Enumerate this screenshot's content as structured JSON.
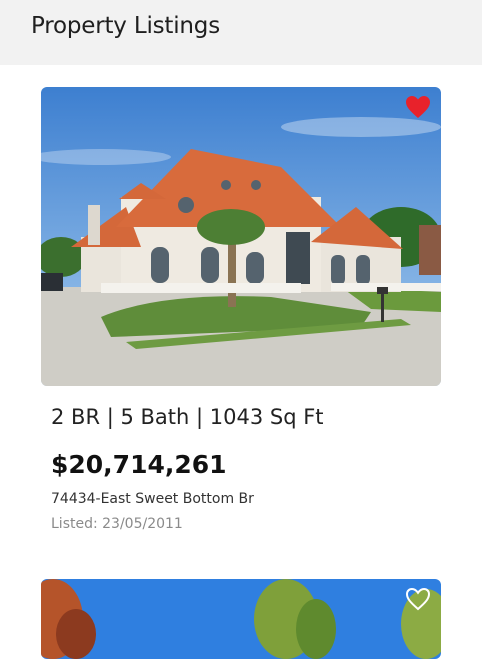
{
  "header": {
    "title": "Property Listings"
  },
  "listings": [
    {
      "specs": "2 BR | 5 Bath | 1043 Sq Ft",
      "price": "$20,714,261",
      "address": "74434-East Sweet Bottom Br",
      "listed": "Listed: 23/05/2011",
      "favorite": true,
      "favorite_icon": "heart-filled-icon"
    },
    {
      "favorite": false,
      "favorite_icon": "heart-outline-icon"
    }
  ],
  "colors": {
    "header_bg": "#f2f2f2",
    "favorite_active": "#e8222b",
    "favorite_inactive": "#ffffff"
  }
}
